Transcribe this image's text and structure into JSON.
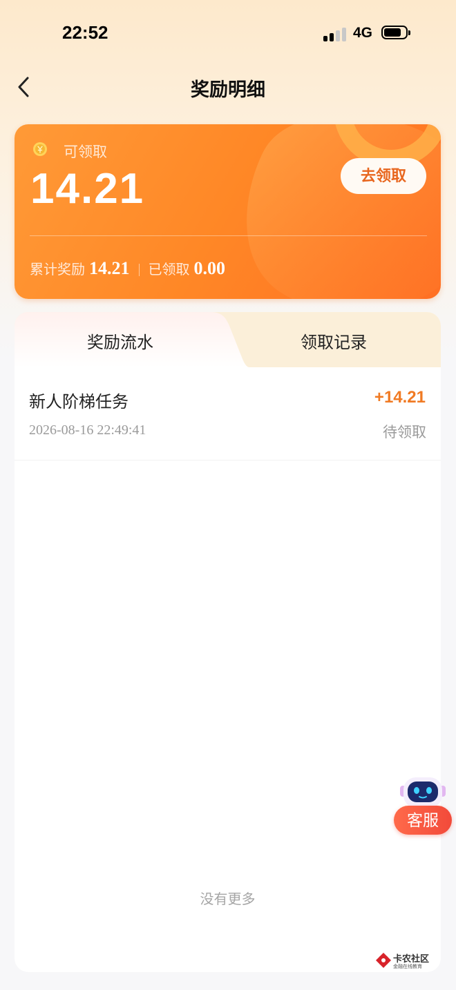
{
  "status_bar": {
    "time": "22:52",
    "network": "4G",
    "signal_bars_active": 2,
    "signal_bars_total": 4
  },
  "nav": {
    "title": "奖励明细",
    "back_icon": "chevron-left-icon"
  },
  "reward_card": {
    "coin_icon": "coin-icon",
    "claimable_label": "可领取",
    "claimable_amount": "14.21",
    "claim_button_label": "去领取",
    "total_label": "累计奖励",
    "total_value": "14.21",
    "claimed_label": "已领取",
    "claimed_value": "0.00"
  },
  "tabs": [
    {
      "label": "奖励流水",
      "active": true
    },
    {
      "label": "领取记录",
      "active": false
    }
  ],
  "records": [
    {
      "title": "新人阶梯任务",
      "amount": "+14.21",
      "time": "2026-08-16 22:49:41",
      "status": "待领取"
    }
  ],
  "list_footer": "没有更多",
  "customer_service": {
    "icon": "robot-icon",
    "label": "客服"
  },
  "watermark": {
    "text": "卡农社区",
    "subtext": "金融在线教育"
  },
  "colors": {
    "accent": "#f07a23",
    "card_gradient_start": "#ff9a37",
    "card_gradient_end": "#ff6f23",
    "cs_button": "#f24a3a"
  }
}
